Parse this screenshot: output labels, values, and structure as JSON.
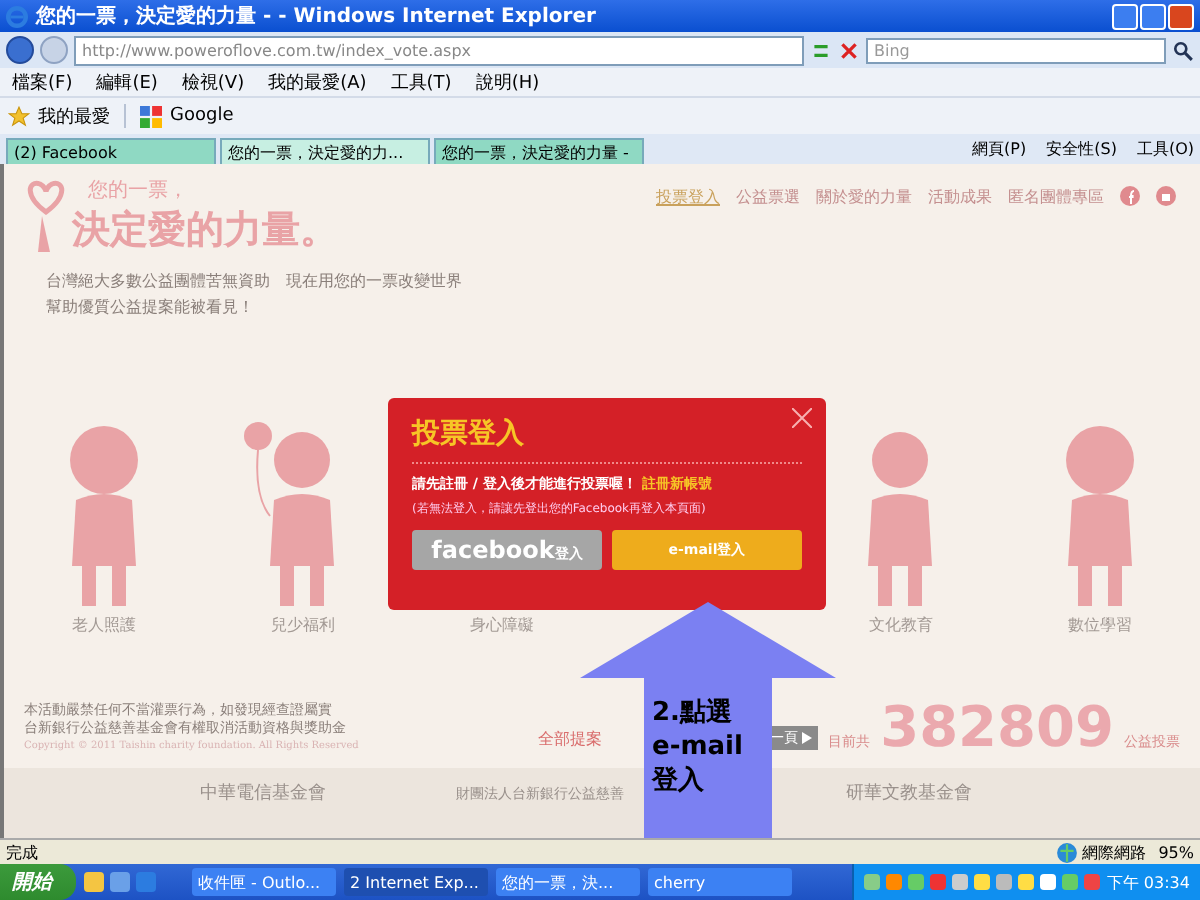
{
  "window": {
    "title": "您的一票，決定愛的力量 - - Windows Internet Explorer"
  },
  "address_bar": {
    "url": "http://www.poweroflove.com.tw/index_vote.aspx",
    "search_placeholder": "Bing"
  },
  "menu": [
    "檔案(F)",
    "編輯(E)",
    "檢視(V)",
    "我的最愛(A)",
    "工具(T)",
    "說明(H)"
  ],
  "favorites_bar": {
    "favorites_label": "我的最愛",
    "links": [
      "Google"
    ]
  },
  "tabs": [
    {
      "label": "(2) Facebook",
      "selected": false
    },
    {
      "label": "您的一票，決定愛的力...",
      "selected": true
    },
    {
      "label": "您的一票，決定愛的力量 -",
      "selected": false
    }
  ],
  "command_bar": [
    "網頁(P)",
    "安全性(S)",
    "工具(O)"
  ],
  "page": {
    "logo": {
      "small": "您的一票，",
      "large": "決定愛的力量。"
    },
    "nav": [
      {
        "label": "投票登入",
        "selected": true
      },
      {
        "label": "公益票選",
        "selected": false
      },
      {
        "label": "關於愛的力量",
        "selected": false
      },
      {
        "label": "活動成果",
        "selected": false
      },
      {
        "label": "匿名團體專區",
        "selected": false
      }
    ],
    "tagline": [
      "台灣絕大多數公益團體苦無資助　現在用您的一票改變世界",
      "幫助優質公益提案能被看見！"
    ],
    "categories": [
      "老人照護",
      "兒少福利",
      "身心障礙",
      "文化教育",
      "數位學習"
    ],
    "disclaimer": [
      "本活動嚴禁任何不當灌票行為，如發現經查證屬實",
      "台新銀行公益慈善基金會有權取消活動資格與獎助金"
    ],
    "copyright": "Copyright © 2011 Taishin charity foundation. All Rights Reserved",
    "all_proposals_link": "全部提案",
    "next_button": "一頁",
    "vote_count": {
      "prefix": "目前共",
      "count": "382809",
      "suffix": "公益投票"
    },
    "sponsors": [
      "中華電信基金會",
      "財團法人台新銀行公益慈善",
      "研華文教基金會"
    ]
  },
  "login_modal": {
    "title": "投票登入",
    "message": "請先註冊 / 登入後才能進行投票喔！",
    "register_link": "註冊新帳號",
    "note": "(若無法登入，請讓先登出您的Facebook再登入本頁面)",
    "buttons": [
      {
        "kind": "facebook",
        "label": "**facebook**登入"
      },
      {
        "kind": "email",
        "label": "e-mail登入"
      }
    ]
  },
  "annotation": {
    "lines": [
      "2.點選",
      "e-mail",
      "登入"
    ]
  },
  "status_bar": {
    "status": "完成",
    "zone": "網際網路",
    "zoom": "95%"
  },
  "taskbar": {
    "start": "開始",
    "tasks": [
      {
        "label": "收件匣 - Outlo...",
        "selected": false
      },
      {
        "label": "2 Internet Exp...",
        "selected": true
      },
      {
        "label": "您的一票，決...",
        "selected": false
      },
      {
        "label": "cherry",
        "selected": false
      }
    ],
    "clock": "下午 03:34"
  }
}
